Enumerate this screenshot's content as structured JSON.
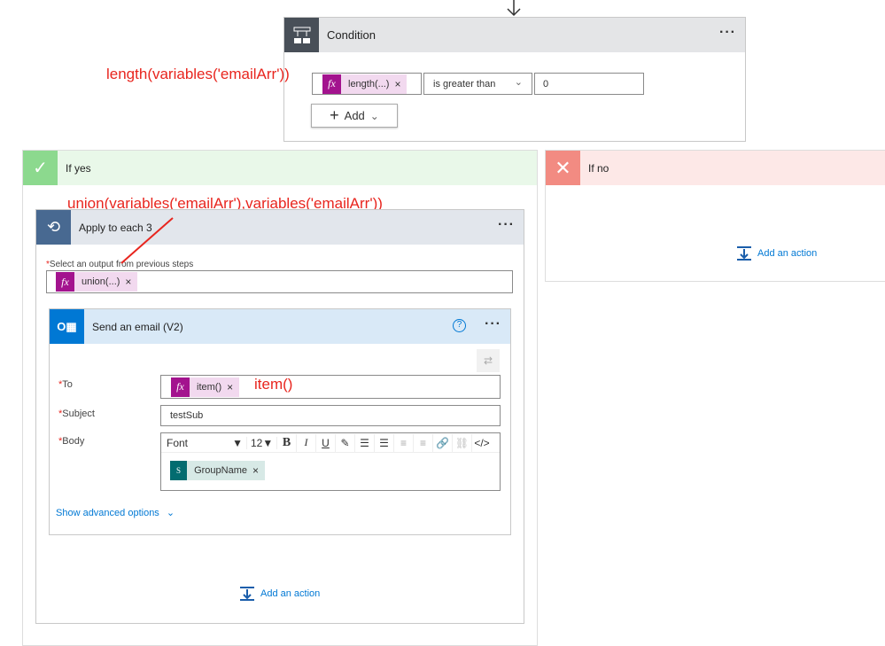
{
  "condition": {
    "title": "Condition",
    "operand": "length(...)",
    "operator": "is greater than",
    "value": "0",
    "add_label": "Add"
  },
  "annotations": {
    "length": "length(variables('emailArr'))",
    "union": "union(variables('emailArr'),variables('emailArr'))",
    "item": "item()"
  },
  "if_yes": {
    "title": "If yes"
  },
  "if_no": {
    "title": "If no",
    "add_action": "Add an action"
  },
  "apply_each": {
    "title": "Apply to each 3",
    "select_label": "Select an output from previous steps",
    "token": "union(...)",
    "add_action": "Add an action"
  },
  "email": {
    "title": "Send an email (V2)",
    "to_label": "To",
    "to_token": "item()",
    "subject_label": "Subject",
    "subject_value": "testSub",
    "body_label": "Body",
    "font": "Font",
    "size": "12",
    "body_token": "GroupName",
    "advanced": "Show advanced options"
  },
  "colors": {
    "annotation": "#e8251e",
    "fx_token": "#a3138e",
    "link": "#0078d4"
  }
}
